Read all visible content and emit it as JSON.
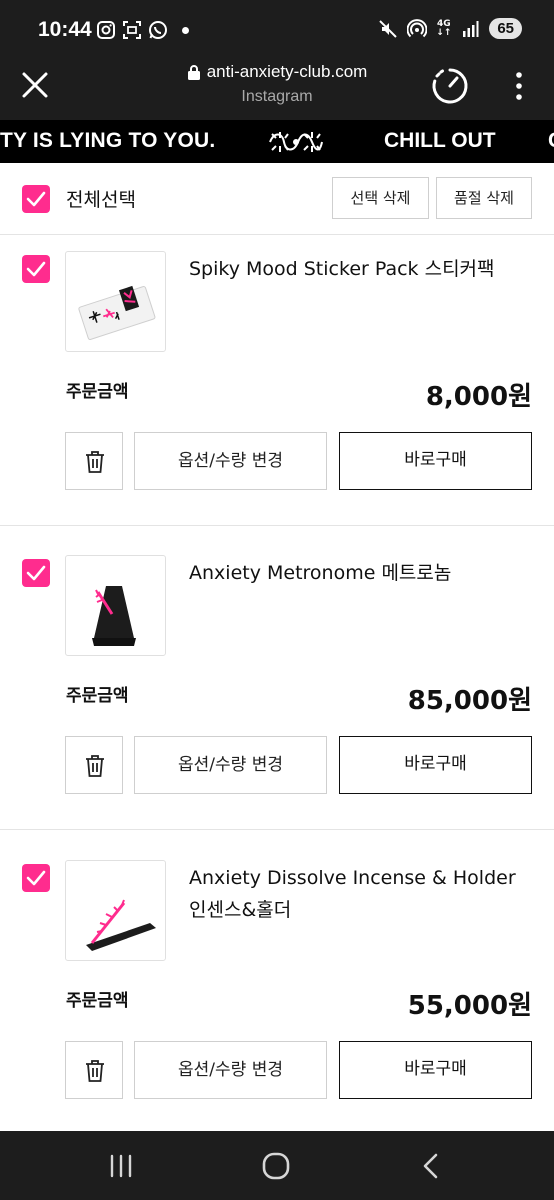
{
  "status_bar": {
    "time": "10:44",
    "network_top": "4G",
    "network_bottom": "↓↑",
    "battery": "65",
    "icons": [
      "instagram-icon",
      "screenshot-icon",
      "whatsapp-icon",
      "mute-icon",
      "hotspot-icon",
      "signal-icon"
    ]
  },
  "browser": {
    "url": "anti-anxiety-club.com",
    "source": "Instagram"
  },
  "banner": {
    "text_left": "TY IS LYING TO YOU.",
    "text_right": "CHILL OUT",
    "text_edge": "C"
  },
  "cart": {
    "select_all_label": "전체선택",
    "delete_selected_label": "선택 삭제",
    "delete_soldout_label": "품절 삭제",
    "items": [
      {
        "name": "Spiky Mood Sticker Pack 스티커팩",
        "amount_label": "주문금액",
        "price": "8,000원",
        "option_label": "옵션/수량 변경",
        "buy_label": "바로구매"
      },
      {
        "name": "Anxiety Metronome 메트로놈",
        "amount_label": "주문금액",
        "price": "85,000원",
        "option_label": "옵션/수량 변경",
        "buy_label": "바로구매"
      },
      {
        "name": "Anxiety Dissolve Incense & Holder 인센스&홀더",
        "amount_label": "주문금액",
        "price": "55,000원",
        "option_label": "옵션/수량 변경",
        "buy_label": "바로구매"
      }
    ]
  },
  "colors": {
    "accent": "#ff2c8e",
    "dark_bar": "#1d1d1d",
    "banner": "#000000"
  }
}
